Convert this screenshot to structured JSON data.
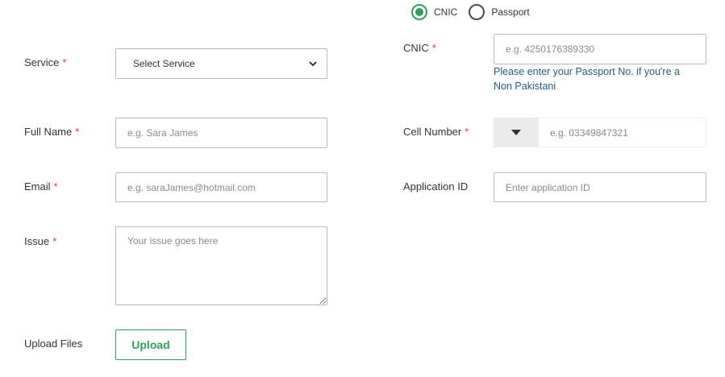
{
  "id_type": {
    "options": [
      {
        "label": "CNIC",
        "checked": true
      },
      {
        "label": "Passport",
        "checked": false
      }
    ]
  },
  "accent_color": "#2e9e5b",
  "required_marker": "*",
  "service": {
    "label": "Service",
    "selected": "Select Service",
    "icon": "chevron-down-icon"
  },
  "cnic": {
    "label": "CNIC",
    "placeholder": "e.g. 4250176389330",
    "value": "",
    "hint": "Please enter your Passport No. if you're a Non Pakistani"
  },
  "full_name": {
    "label": "Full Name",
    "placeholder": "e.g. Sara James",
    "value": ""
  },
  "cell_number": {
    "label": "Cell Number",
    "placeholder": "e.g. 03349847321",
    "value": "",
    "country_icon": "caret-down-icon"
  },
  "email": {
    "label": "Email",
    "placeholder": "e.g. saraJames@hotmail.com",
    "value": ""
  },
  "application_id": {
    "label": "Application ID",
    "placeholder": "Enter application ID",
    "value": ""
  },
  "issue": {
    "label": "Issue",
    "placeholder": "Your issue goes here",
    "value": ""
  },
  "upload": {
    "label": "Upload Files",
    "button": "Upload"
  }
}
